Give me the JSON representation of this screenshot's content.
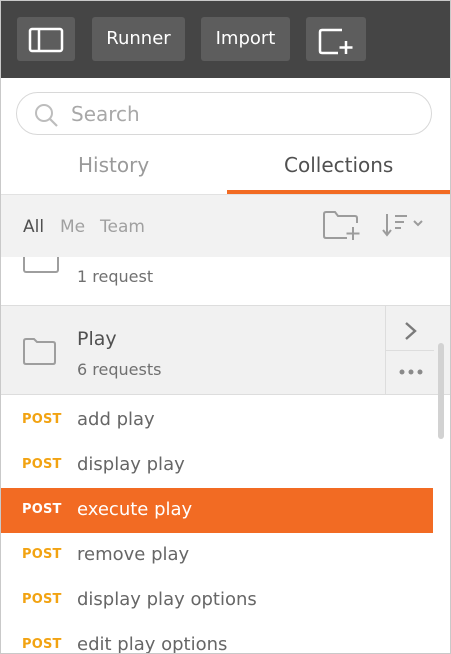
{
  "toolbar": {
    "runner_label": "Runner",
    "import_label": "Import"
  },
  "search": {
    "placeholder": "Search"
  },
  "tabs": [
    {
      "label": "History",
      "active": false
    },
    {
      "label": "Collections",
      "active": true
    }
  ],
  "filters": [
    {
      "label": "All",
      "active": true
    },
    {
      "label": "Me",
      "active": false
    },
    {
      "label": "Team",
      "active": false
    }
  ],
  "collections": [
    {
      "requests_text": "1 request"
    },
    {
      "name": "Play",
      "requests_text": "6 requests"
    }
  ],
  "requests": [
    {
      "method": "POST",
      "name": "add play",
      "selected": false
    },
    {
      "method": "POST",
      "name": "display play",
      "selected": false
    },
    {
      "method": "POST",
      "name": "execute play",
      "selected": true
    },
    {
      "method": "POST",
      "name": "remove play",
      "selected": false
    },
    {
      "method": "POST",
      "name": "display play options",
      "selected": false
    },
    {
      "method": "POST",
      "name": "edit play options",
      "selected": false
    }
  ],
  "colors": {
    "accent": "#f26b23",
    "toolbar_bg": "#454545",
    "post_method": "#f2a312"
  },
  "icons": [
    "sidebar-toggle-icon",
    "new-window-icon",
    "search-icon",
    "new-folder-icon",
    "sort-icon",
    "folder-icon",
    "chevron-right-icon",
    "more-icon"
  ]
}
